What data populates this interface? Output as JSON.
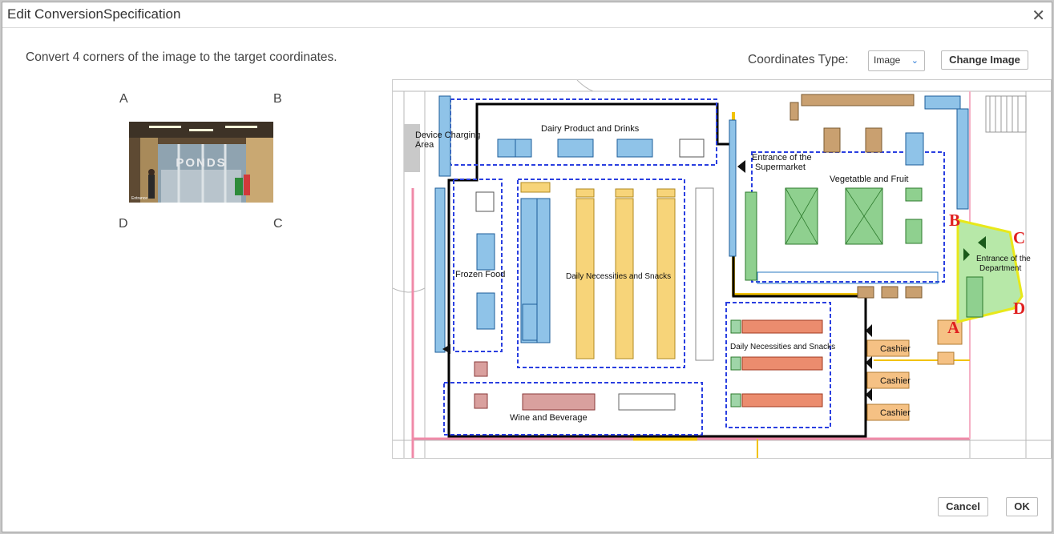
{
  "window": {
    "title": "Edit ConversionSpecification"
  },
  "instructions": "Convert 4 corners of the image to the target coordinates.",
  "corners": {
    "a": "A",
    "b": "B",
    "c": "C",
    "d": "D"
  },
  "thumbnail": {
    "text": "PONDS",
    "caption": "Entrance"
  },
  "coordinates": {
    "label": "Coordinates Type:",
    "value": "Image"
  },
  "buttons": {
    "change_image": "Change Image",
    "cancel": "Cancel",
    "ok": "OK"
  },
  "floorplan": {
    "zones": {
      "device_charging_1": "Device Charging",
      "device_charging_2": "Area",
      "dairy": "Dairy Product and Drinks",
      "entrance_supermarket_1": "Entrance of the",
      "entrance_supermarket_2": "Supermarket",
      "vegetable": "Vegetatble and Fruit",
      "frozen": "Frozen Food",
      "daily_left": "Daily Necessities and Snacks",
      "daily_right": "Daily Necessities and Snacks",
      "wine": "Wine and Beverage",
      "cashier_1": "Cashier",
      "cashier_2": "Cashier",
      "cashier_3": "Cashier",
      "entrance_dept_1": "Entrance of the",
      "entrance_dept_2": "Department"
    },
    "markers": {
      "a": "A",
      "b": "B",
      "c": "C",
      "d": "D"
    }
  },
  "colors": {
    "accent": "#2a7bd8",
    "marker": "#e02020",
    "region": "#b7e8a8",
    "region_border": "#e8e81a"
  }
}
